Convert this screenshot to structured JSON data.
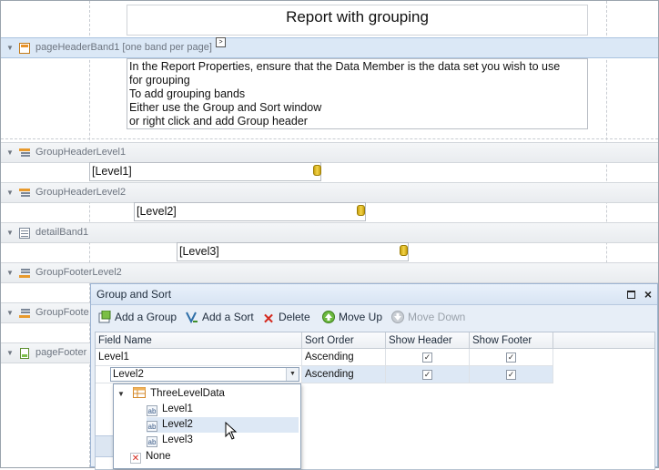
{
  "designer": {
    "report_title": "Report with grouping",
    "page_header_band": "pageHeaderBand1 [one band per page]",
    "info_lines": [
      "In the Report Properties, ensure that the Data Member is the data set you wish to use",
      "for grouping",
      "To add grouping bands",
      "Either use the Group and Sort window",
      "or right click and add Group header"
    ],
    "bands": {
      "group_header_1": "GroupHeaderLevel1",
      "group_header_2": "GroupHeaderLevel2",
      "detail": "detailBand1",
      "group_footer_2": "GroupFooterLevel2",
      "group_footer_1_partial": "GroupFoote",
      "page_footer_partial": "pageFooter"
    },
    "fields": {
      "level1": "[Level1]",
      "level2": "[Level2]",
      "level3": "[Level3]"
    }
  },
  "group_sort": {
    "title": "Group and Sort",
    "toolbar": {
      "add_group": "Add a Group",
      "add_sort": "Add a Sort",
      "delete": "Delete",
      "move_up": "Move Up",
      "move_down": "Move Down"
    },
    "columns": [
      "Field Name",
      "Sort Order",
      "Show Header",
      "Show Footer"
    ],
    "rows": [
      {
        "field": "Level1",
        "sort": "Ascending",
        "show_header": true,
        "show_footer": true
      },
      {
        "field": "Level2",
        "sort": "Ascending",
        "show_header": true,
        "show_footer": true
      }
    ],
    "dropdown": {
      "root": "ThreeLevelData",
      "items": [
        "Level1",
        "Level2",
        "Level3"
      ],
      "selected": "Level2",
      "none": "None"
    }
  },
  "colors": {
    "selection": "#dde8f5",
    "band_bar": "#e9ecef"
  }
}
